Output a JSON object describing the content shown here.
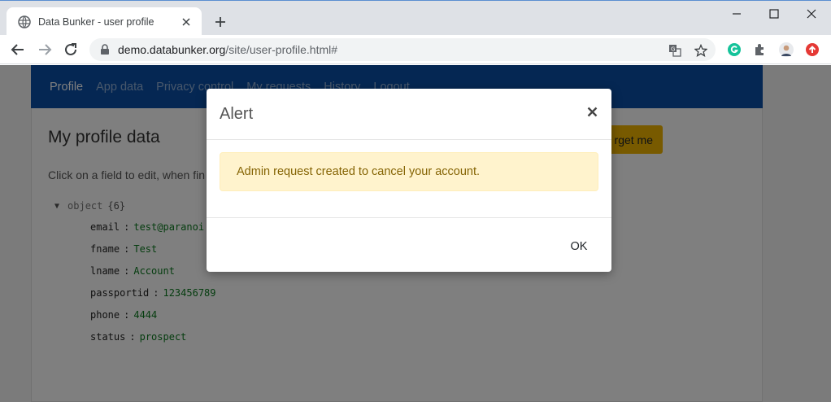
{
  "browser": {
    "tab_title": "Data Bunker - user profile",
    "url_host": "demo.databunker.org",
    "url_path": "/site/user-profile.html#"
  },
  "site_nav": {
    "items": [
      {
        "label": "Profile",
        "active": true
      },
      {
        "label": "App data",
        "active": false
      },
      {
        "label": "Privacy control",
        "active": false
      },
      {
        "label": "My requests",
        "active": false
      },
      {
        "label": "History",
        "active": false
      },
      {
        "label": "Logout",
        "active": false
      }
    ]
  },
  "profile": {
    "title": "My profile data",
    "hint": "Click on a field to edit, when fin",
    "forget_button": "rget me",
    "tree": {
      "root_label": "object",
      "count": "{6}",
      "fields": [
        {
          "key": "email",
          "value": "test@paranoi"
        },
        {
          "key": "fname",
          "value": "Test"
        },
        {
          "key": "lname",
          "value": "Account"
        },
        {
          "key": "passportid",
          "value": "123456789"
        },
        {
          "key": "phone",
          "value": "4444"
        },
        {
          "key": "status",
          "value": "prospect"
        }
      ]
    }
  },
  "modal": {
    "title": "Alert",
    "message": "Admin request created to cancel your account.",
    "ok_label": "OK"
  },
  "colors": {
    "nav_bg": "#0a4fa6",
    "alert_bg": "#fff3cd",
    "alert_text": "#856404",
    "forget_btn": "#f0b400",
    "json_value": "#0b7a1f"
  }
}
